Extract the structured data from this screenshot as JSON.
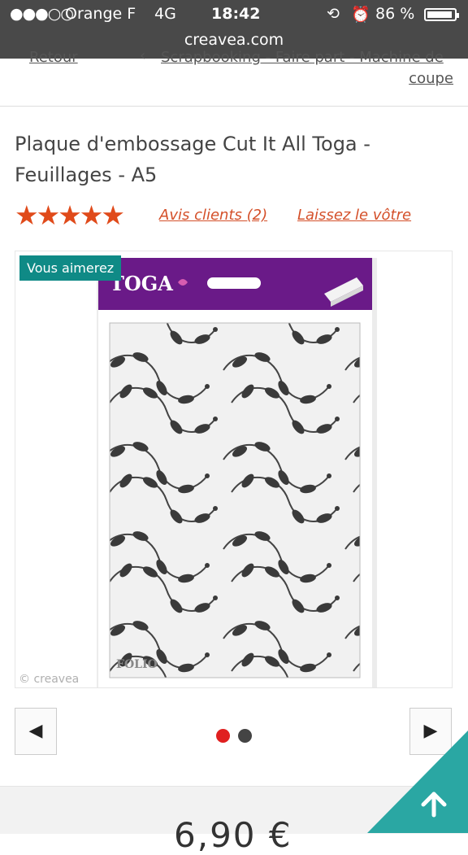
{
  "status_bar": {
    "signal": "●●●○○",
    "carrier": "Orange F",
    "network": "4G",
    "time": "18:42",
    "lock_glyph": "⟲",
    "alarm_glyph": "⏰",
    "battery_percent": "86 %",
    "battery_level": 0.86,
    "url": "creavea.com"
  },
  "breadcrumb": {
    "back": "Retour",
    "separator": "‹",
    "path": "Scrapbooking - Faire part - Machine de",
    "path_wrap": "coupe"
  },
  "product": {
    "title": "Plaque d'embossage Cut It All Toga - Feuillages - A5",
    "rating_stars": 5,
    "reviews_link": "Avis clients (2)",
    "write_review_link": "Laissez le vôtre",
    "badge": "Vous aimerez",
    "package_brand": "TOGA",
    "package_small_label": "FOLIO",
    "watermark": "© creavea",
    "price": "6,90 €"
  },
  "carousel": {
    "prev_glyph": "◀",
    "next_glyph": "▶",
    "active_index": 0,
    "count": 2
  },
  "colors": {
    "accent_star": "#e04a1a",
    "link": "#d4502a",
    "badge": "#0f8a86",
    "package_header": "#6a1a88",
    "scroll_top": "#2aa7a3"
  }
}
